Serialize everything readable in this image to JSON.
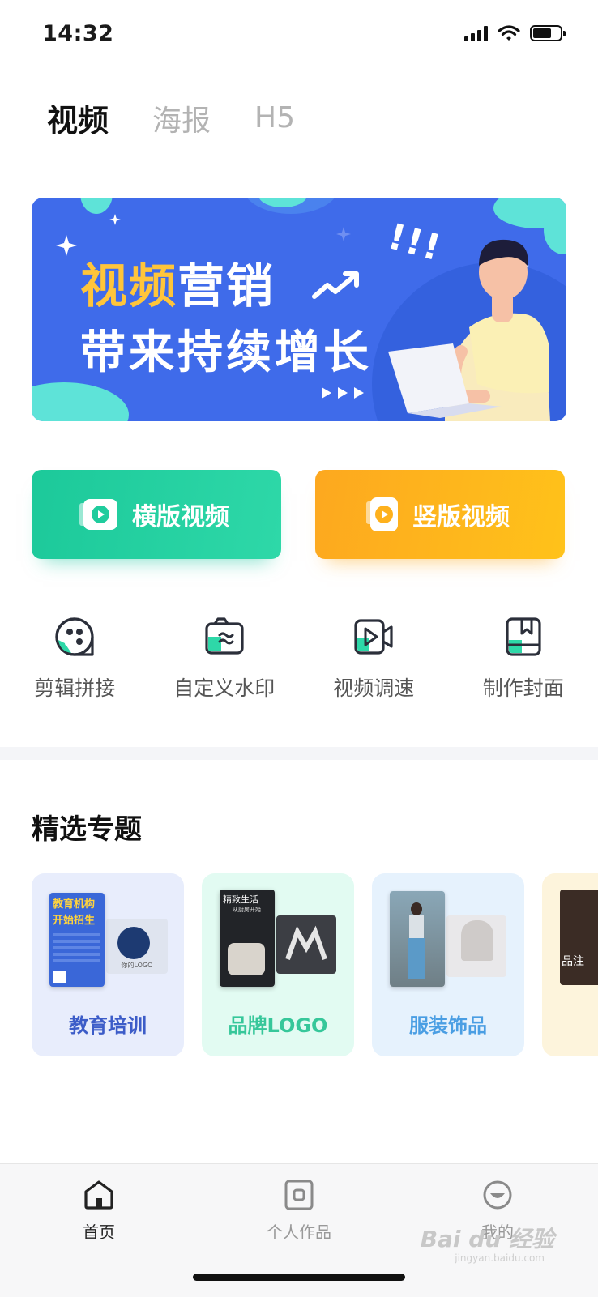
{
  "status_bar": {
    "time": "14:32"
  },
  "tabs": [
    {
      "label": "视频",
      "active": true
    },
    {
      "label": "海报",
      "active": false
    },
    {
      "label": "H5",
      "active": false
    }
  ],
  "banner": {
    "line1_highlight": "视频",
    "line1_rest": "营销",
    "line2": "带来持续增长",
    "exclaim": "!!!"
  },
  "create_buttons": {
    "landscape": {
      "label": "横版视频",
      "color": "#1fcc9d"
    },
    "portrait": {
      "label": "竖版视频",
      "color": "#feb11d"
    }
  },
  "tools": [
    {
      "label": "剪辑拼接",
      "icon": "cut-splice-icon"
    },
    {
      "label": "自定义水印",
      "icon": "watermark-icon"
    },
    {
      "label": "视频调速",
      "icon": "video-speed-icon"
    },
    {
      "label": "制作封面",
      "icon": "cover-icon"
    }
  ],
  "featured": {
    "title": "精选专题",
    "cards": [
      {
        "label": "教育培训",
        "img_title_1": "教育机构",
        "img_title_2": "开始招生",
        "img_side_text": "你的LOGO"
      },
      {
        "label": "品牌LOGO",
        "img_title": "精致生活",
        "img_subtitle": "从厨房开始"
      },
      {
        "label": "服装饰品"
      },
      {
        "label": "",
        "img_text": "品注"
      }
    ]
  },
  "bottom_nav": [
    {
      "label": "首页",
      "icon": "home-icon",
      "active": true
    },
    {
      "label": "个人作品",
      "icon": "works-icon",
      "active": false
    },
    {
      "label": "我的",
      "icon": "profile-icon",
      "active": false
    }
  ],
  "watermark": {
    "text": "Bai du 经验",
    "sub": "jingyan.baidu.com"
  },
  "colors": {
    "accent_green": "#1fcc9d",
    "accent_orange": "#feb11d",
    "banner_blue": "#3f6bea"
  }
}
